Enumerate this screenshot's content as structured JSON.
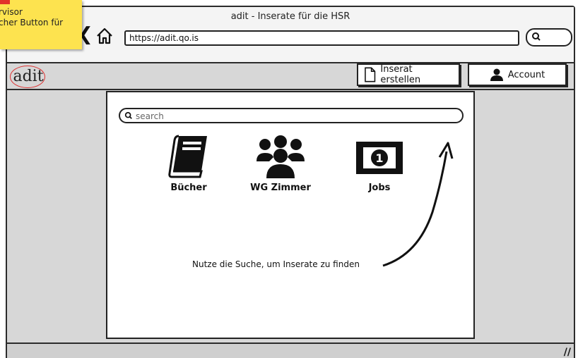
{
  "sticky_note": {
    "line1": "rvisor",
    "line2": "cher Button für"
  },
  "window": {
    "title": "adit - Inserate für die HSR"
  },
  "address_bar": {
    "url": "https://adit.qo.is"
  },
  "app": {
    "logo_text": "adit"
  },
  "header": {
    "create_label": "Inserat erstellen",
    "account_label": "Account"
  },
  "search": {
    "placeholder": "search",
    "value": ""
  },
  "categories": [
    {
      "label": "Bücher",
      "icon": "book-icon"
    },
    {
      "label": "WG Zimmer",
      "icon": "group-icon"
    },
    {
      "label": "Jobs",
      "icon": "money-icon"
    }
  ],
  "hint": "Nutze die Suche, um Inserate zu finden",
  "colors": {
    "sticky": "#fde34f",
    "pin": "#e2342a",
    "frame": "#2b2b2b",
    "background": "#d7d7d7"
  }
}
